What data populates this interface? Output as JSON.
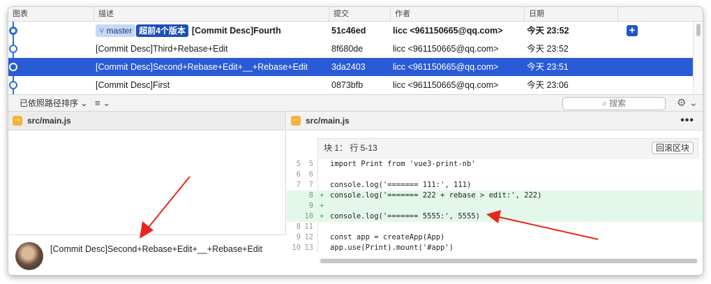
{
  "table": {
    "headers": {
      "graph": "图表",
      "description": "描述",
      "commit": "提交",
      "author": "作者",
      "date": "日期"
    },
    "rows": [
      {
        "branch": "master",
        "ahead": "超前4个版本",
        "message": "[Commit Desc]Fourth",
        "hash": "51c46ed",
        "author": "licc <961150665@qq.com>",
        "date": "今天 23:52"
      },
      {
        "message": "[Commit Desc]Third+Rebase+Edit",
        "hash": "8f680de",
        "author": "licc <961150665@qq.com>",
        "date": "今天 23:52"
      },
      {
        "message": "[Commit Desc]Second+Rebase+Edit+__+Rebase+Edit",
        "hash": "3da2403",
        "author": "licc <961150665@qq.com>",
        "date": "今天 23:51"
      },
      {
        "message": "[Commit Desc]First",
        "hash": "0873bfb",
        "author": "licc <961150665@qq.com>",
        "date": "今天 23:06"
      }
    ],
    "add_label": "+"
  },
  "toolbar": {
    "sort_label": "已依照路径排序",
    "list_icon": "≡",
    "search_placeholder": "搜索",
    "search_icon": "⌕",
    "gear_icon": "⚙"
  },
  "left_pane": {
    "file_name": "src/main.js",
    "commit_message": "[Commit Desc]Second+Rebase+Edit+__+Rebase+Edit"
  },
  "right_pane": {
    "file_name": "src/main.js",
    "more_icon": "•••",
    "hunk_label": "块 1： 行 5-13",
    "revert_label": "回滚区块",
    "lines": [
      {
        "old": "5",
        "new": "5",
        "type": "ctx",
        "text": "import Print from 'vue3-print-nb'"
      },
      {
        "old": "6",
        "new": "6",
        "type": "ctx",
        "text": ""
      },
      {
        "old": "7",
        "new": "7",
        "type": "ctx",
        "text": "console.log('======= 111:', 111)"
      },
      {
        "old": "",
        "new": "8",
        "type": "add",
        "text": "console.log('======= 222 + rebase > edit:', 222)"
      },
      {
        "old": "",
        "new": "9",
        "type": "add",
        "text": ""
      },
      {
        "old": "",
        "new": "10",
        "type": "add",
        "text": "console.log('======= 5555:', 5555)"
      },
      {
        "old": "8",
        "new": "11",
        "type": "ctx",
        "text": ""
      },
      {
        "old": "9",
        "new": "12",
        "type": "ctx",
        "text": "const app = createApp(App)"
      },
      {
        "old": "10",
        "new": "13",
        "type": "ctx",
        "text": "app.use(Print).mount('#app')"
      }
    ]
  },
  "colors": {
    "selection": "#2a5bd7",
    "graph": "#2a6ed6",
    "added_bg": "#e3f8ea",
    "arrow": "#e8271b",
    "file_icon": "#f3b23a"
  }
}
